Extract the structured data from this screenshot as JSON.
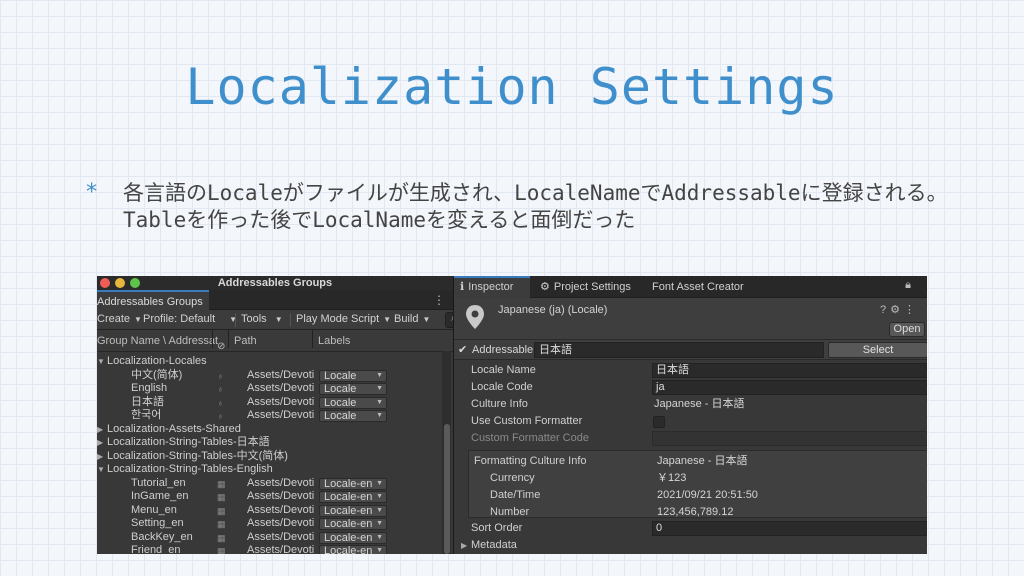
{
  "slide": {
    "title": "Localization Settings",
    "bullet_symbol": "*",
    "bullet_text": "各言語のLocaleがファイルが生成され、LocaleNameでAddressableに登録される。Tableを作った後でLocalNameを変えると面倒だった"
  },
  "addressables": {
    "window_title": "Addressables Groups",
    "tab_label": "Addressables Groups",
    "toolbar": {
      "create": "Create",
      "profile": "Profile: Default",
      "tools": "Tools",
      "play_mode": "Play Mode Script",
      "build": "Build"
    },
    "columns": {
      "name": "Group Name \\ Addressat",
      "path": "Path",
      "labels": "Labels"
    },
    "rows": [
      {
        "kind": "group",
        "expanded": true,
        "name": "Localization-Locales"
      },
      {
        "kind": "entry",
        "name": "中文(简体)",
        "path": "Assets/Devoti",
        "label": "Locale"
      },
      {
        "kind": "entry",
        "name": "English",
        "path": "Assets/Devoti",
        "label": "Locale"
      },
      {
        "kind": "entry",
        "name": "日本語",
        "path": "Assets/Devoti",
        "label": "Locale"
      },
      {
        "kind": "entry",
        "name": "한국어",
        "path": "Assets/Devoti",
        "label": "Locale"
      },
      {
        "kind": "group",
        "expanded": false,
        "name": "Localization-Assets-Shared"
      },
      {
        "kind": "group",
        "expanded": false,
        "name": "Localization-String-Tables-日本語"
      },
      {
        "kind": "group",
        "expanded": false,
        "name": "Localization-String-Tables-中文(简体)"
      },
      {
        "kind": "group",
        "expanded": true,
        "name": "Localization-String-Tables-English"
      },
      {
        "kind": "entry",
        "name": "Tutorial_en",
        "path": "Assets/Devoti",
        "label": "Locale-en"
      },
      {
        "kind": "entry",
        "name": "InGame_en",
        "path": "Assets/Devoti",
        "label": "Locale-en"
      },
      {
        "kind": "entry",
        "name": "Menu_en",
        "path": "Assets/Devoti",
        "label": "Locale-en"
      },
      {
        "kind": "entry",
        "name": "Setting_en",
        "path": "Assets/Devoti",
        "label": "Locale-en"
      },
      {
        "kind": "entry",
        "name": "BackKey_en",
        "path": "Assets/Devoti",
        "label": "Locale-en"
      },
      {
        "kind": "entry",
        "name": "Friend_en",
        "path": "Assets/Devoti",
        "label": "Locale-en"
      }
    ]
  },
  "inspector": {
    "tabs": [
      "Inspector",
      "Project Settings",
      "Font Asset Creator"
    ],
    "header_title": "Japanese (ja) (Locale)",
    "open_label": "Open",
    "addressable_label": "Addressable",
    "addressable_value": "日本語",
    "select_label": "Select",
    "properties": [
      {
        "label": "Locale Name",
        "value": "日本語",
        "kind": "field"
      },
      {
        "label": "Locale Code",
        "value": "ja",
        "kind": "field"
      },
      {
        "label": "Culture Info",
        "value": "Japanese - 日本語",
        "kind": "text"
      },
      {
        "label": "Use Custom Formatter",
        "value": "",
        "kind": "checkbox"
      },
      {
        "label": "Custom Formatter Code",
        "value": "",
        "kind": "disabled"
      }
    ],
    "formatting": {
      "label": "Formatting Culture Info",
      "value": "Japanese - 日本語",
      "rows": [
        {
          "label": "Currency",
          "value": "￥123"
        },
        {
          "label": "Date/Time",
          "value": "2021/09/21 20:51:50"
        },
        {
          "label": "Number",
          "value": "123,456,789.12"
        }
      ]
    },
    "sort_order_label": "Sort Order",
    "sort_order_value": "0",
    "metadata_label": "Metadata"
  }
}
